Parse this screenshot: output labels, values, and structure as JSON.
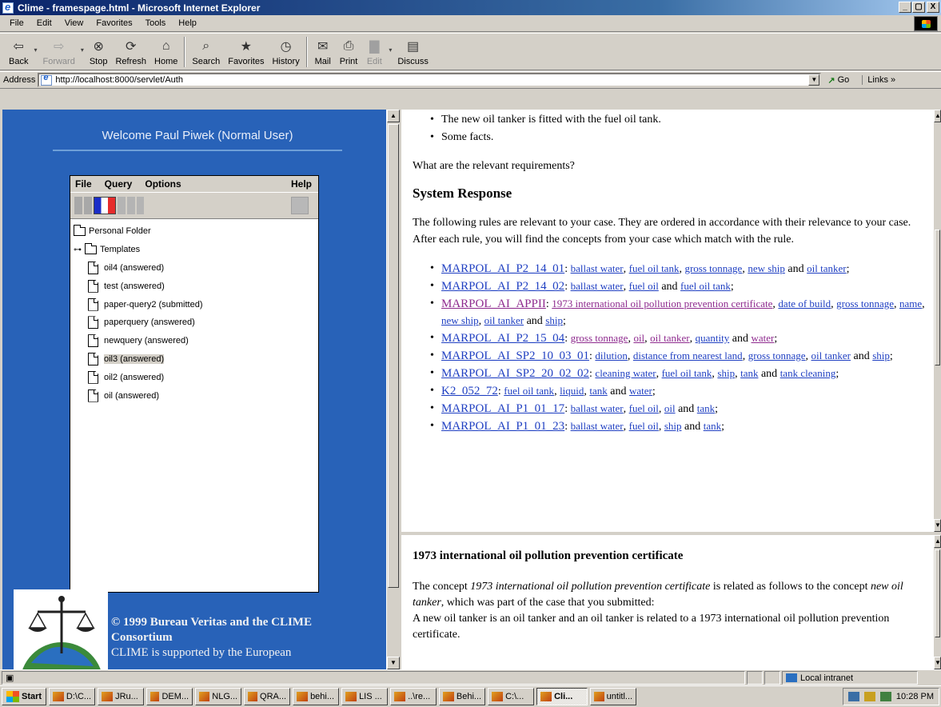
{
  "window": {
    "title": "Clime - framespage.html - Microsoft Internet Explorer",
    "controls": [
      "_",
      "Д",
      "X"
    ]
  },
  "menu": [
    "File",
    "Edit",
    "View",
    "Favorites",
    "Tools",
    "Help"
  ],
  "toolbar": {
    "buttons": [
      {
        "label": "Back",
        "icon": "back-arrow-icon",
        "enabled": true
      },
      {
        "label": "Forward",
        "icon": "forward-arrow-icon",
        "enabled": false
      },
      {
        "label": "Stop",
        "icon": "stop-icon",
        "enabled": true
      },
      {
        "label": "Refresh",
        "icon": "refresh-icon",
        "enabled": true
      },
      {
        "label": "Home",
        "icon": "home-icon",
        "enabled": true
      },
      {
        "label": "Search",
        "icon": "search-icon",
        "enabled": true
      },
      {
        "label": "Favorites",
        "icon": "favorites-icon",
        "enabled": true
      },
      {
        "label": "History",
        "icon": "history-icon",
        "enabled": true
      },
      {
        "label": "Mail",
        "icon": "mail-icon",
        "enabled": true
      },
      {
        "label": "Print",
        "icon": "print-icon",
        "enabled": true
      },
      {
        "label": "Edit",
        "icon": "edit-icon",
        "enabled": false
      },
      {
        "label": "Discuss",
        "icon": "discuss-icon",
        "enabled": true
      }
    ]
  },
  "address": {
    "label": "Address",
    "url": "http://localhost:8000/servlet/Auth",
    "go_label": "Go",
    "links_label": "Links"
  },
  "left": {
    "welcome": "Welcome Paul Piwek (Normal User)",
    "applet_menu": {
      "file": "File",
      "query": "Query",
      "options": "Options",
      "help": "Help"
    },
    "tree": {
      "root": "Personal Folder",
      "folder": "Templates",
      "items": [
        {
          "label": "oil4 (answered)",
          "selected": false
        },
        {
          "label": "test (answered)",
          "selected": false
        },
        {
          "label": "paper-query2 (submitted)",
          "selected": false
        },
        {
          "label": "paperquery (answered)",
          "selected": false
        },
        {
          "label": "newquery (answered)",
          "selected": false
        },
        {
          "label": "oil3 (answered)",
          "selected": true
        },
        {
          "label": "oil2 (answered)",
          "selected": false
        },
        {
          "label": "oil (answered)",
          "selected": false
        }
      ]
    },
    "copyright_line1": "© 1999 Bureau Veritas and the CLIME",
    "copyright_line2": "Consortium",
    "supported_text": "CLIME is supported by the European"
  },
  "main": {
    "intro_bullets": [
      "The new oil tanker is fitted with the fuel oil tank.",
      "Some facts."
    ],
    "question": "What are the relevant requirements?",
    "heading": "System Response",
    "description": "The following rules are relevant to your case. They are ordered in accordance with their relevance to your case. After each rule, you will find the concepts from your case which match with the rule.",
    "rules": [
      {
        "rule": "MARPOL_AI_P2_14_01",
        "concepts": [
          [
            "ballast water",
            false
          ],
          [
            "fuel oil tank",
            false
          ],
          [
            "gross tonnage",
            false
          ],
          [
            "new ship",
            false
          ],
          [
            "oil tanker",
            false
          ]
        ]
      },
      {
        "rule": "MARPOL_AI_P2_14_02",
        "concepts": [
          [
            "ballast water",
            false
          ],
          [
            "fuel oil",
            false
          ],
          [
            "fuel oil tank",
            false
          ]
        ]
      },
      {
        "rule": "MARPOL_AI_APPII",
        "visited": true,
        "concepts": [
          [
            "1973 international oil pollution prevention certificate",
            true
          ],
          [
            "date of build",
            false
          ],
          [
            "gross tonnage",
            false
          ],
          [
            "name",
            false
          ],
          [
            "new ship",
            false
          ],
          [
            "oil tanker",
            false
          ],
          [
            "ship",
            false
          ]
        ]
      },
      {
        "rule": "MARPOL_AI_P2_15_04",
        "concepts": [
          [
            "gross tonnage",
            true
          ],
          [
            "oil",
            true
          ],
          [
            "oil tanker",
            true
          ],
          [
            "quantity",
            false
          ],
          [
            "water",
            true
          ]
        ]
      },
      {
        "rule": "MARPOL_AI_SP2_10_03_01",
        "concepts": [
          [
            "dilution",
            false
          ],
          [
            "distance from nearest land",
            false
          ],
          [
            "gross tonnage",
            false
          ],
          [
            "oil tanker",
            false
          ],
          [
            "ship",
            false
          ]
        ]
      },
      {
        "rule": "MARPOL_AI_SP2_20_02_02",
        "concepts": [
          [
            "cleaning water",
            false
          ],
          [
            "fuel oil tank",
            false
          ],
          [
            "ship",
            false
          ],
          [
            "tank",
            false
          ],
          [
            "tank cleaning",
            false
          ]
        ]
      },
      {
        "rule": "K2_052_72",
        "concepts": [
          [
            "fuel oil tank",
            false
          ],
          [
            "liquid",
            false
          ],
          [
            "tank",
            false
          ],
          [
            "water",
            false
          ]
        ]
      },
      {
        "rule": "MARPOL_AI_P1_01_17",
        "concepts": [
          [
            "ballast water",
            false
          ],
          [
            "fuel oil",
            false
          ],
          [
            "oil",
            false
          ],
          [
            "tank",
            false
          ]
        ]
      },
      {
        "rule": "MARPOL_AI_P1_01_23",
        "concepts": [
          [
            "ballast water",
            false
          ],
          [
            "fuel oil",
            false
          ],
          [
            "ship",
            false
          ],
          [
            "tank",
            false
          ]
        ]
      }
    ]
  },
  "detail": {
    "heading": "1973 international oil pollution prevention certificate",
    "p1_a": "The concept ",
    "p1_concept": "1973 international oil pollution prevention certificate",
    "p1_b": " is related as follows to the concept ",
    "p1_target": "new oil tanker",
    "p1_c": ", which was part of the case that you submitted:",
    "p2": "A new oil tanker is an oil tanker and an oil tanker is related to a 1973 international oil pollution prevention certificate."
  },
  "status": {
    "zone": "Local intranet"
  },
  "taskbar": {
    "start": "Start",
    "tasks": [
      {
        "label": "D:\\C...",
        "active": false
      },
      {
        "label": "JRu...",
        "active": false
      },
      {
        "label": "DEM...",
        "active": false
      },
      {
        "label": "NLG...",
        "active": false
      },
      {
        "label": "QRA...",
        "active": false
      },
      {
        "label": "behi...",
        "active": false
      },
      {
        "label": "LIS ...",
        "active": false
      },
      {
        "label": "..\\re...",
        "active": false
      },
      {
        "label": "Behi...",
        "active": false
      },
      {
        "label": "C:\\...",
        "active": false
      },
      {
        "label": "Cli...",
        "active": true
      },
      {
        "label": "untitl...",
        "active": false
      }
    ],
    "clock": "10:28 PM"
  }
}
